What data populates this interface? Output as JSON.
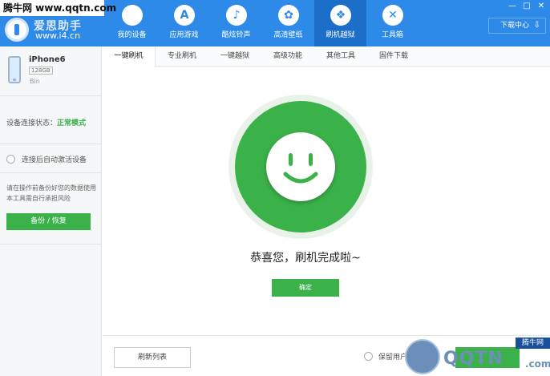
{
  "watermarks": {
    "top_left": "腾牛网 www.qqtn.com",
    "bottom_right_text": "QQTN",
    "bottom_right_suffix": ".com",
    "bottom_right_badge": "腾牛网"
  },
  "app": {
    "logo_title": "爱思助手",
    "logo_url": "www.i4.cn",
    "brand_color": "#2e8ae8",
    "accent_green": "#3bb14a"
  },
  "window_controls": [
    "—",
    "□",
    "✕"
  ],
  "nav": {
    "items": [
      {
        "label": "我的设备",
        "icon": "apple-icon",
        "glyph": ""
      },
      {
        "label": "应用游戏",
        "icon": "app-store-icon",
        "glyph": "A"
      },
      {
        "label": "酷炫铃声",
        "icon": "bell-icon",
        "glyph": "♪"
      },
      {
        "label": "高清壁纸",
        "icon": "flower-icon",
        "glyph": "✿"
      },
      {
        "label": "刷机越狱",
        "icon": "dropbox-icon",
        "glyph": "❖",
        "active": true
      },
      {
        "label": "工具箱",
        "icon": "tools-icon",
        "glyph": "✕"
      }
    ],
    "download_center": "下载中心",
    "download_icon": "download-icon"
  },
  "device": {
    "name": "iPhone6",
    "storage": "128GB",
    "sub": "Bin"
  },
  "sidebar": {
    "conn_label": "设备连接状态：",
    "conn_value": "正常模式",
    "auto_activate_label": "连接后自动激活设备",
    "backup_tip": "请在操作前备份好您的数据使用本工具需自行承担风险",
    "backup_button": "备份 / 恢复"
  },
  "subtabs": [
    "一键刷机",
    "专业刷机",
    "一键越狱",
    "高级功能",
    "其他工具",
    "固件下载"
  ],
  "main": {
    "success_text": "恭喜您，刷机完成啦~",
    "ok_button": "确定",
    "refresh_button": "刷新列表",
    "keep_data_label": "保留用户"
  }
}
